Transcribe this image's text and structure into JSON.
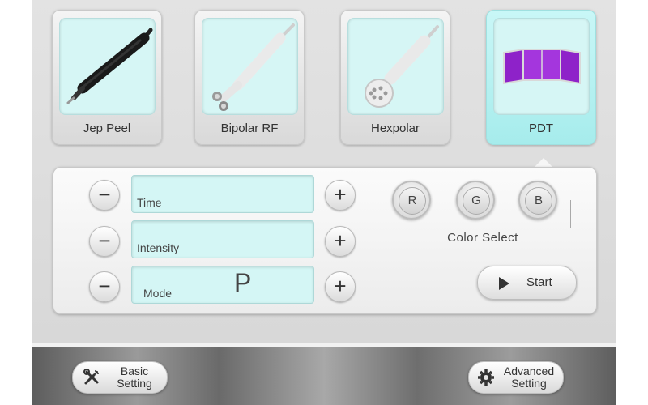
{
  "modes": [
    {
      "label": "Jep Peel",
      "icon": "jep-peel-handpiece-icon",
      "active": false
    },
    {
      "label": "Bipolar RF",
      "icon": "bipolar-rf-handpiece-icon",
      "active": false
    },
    {
      "label": "Hexpolar",
      "icon": "hexpolar-handpiece-icon",
      "active": false
    },
    {
      "label": "PDT",
      "icon": "pdt-light-panel-icon",
      "active": true
    }
  ],
  "controls": {
    "rows": [
      {
        "label": "Time",
        "value": ""
      },
      {
        "label": "Intensity",
        "value": ""
      },
      {
        "label": "Mode",
        "value": "P"
      }
    ],
    "minus_symbol": "−",
    "plus_symbol": "+"
  },
  "color_select": {
    "title": "Color Select",
    "buttons": [
      "R",
      "G",
      "B"
    ]
  },
  "start": {
    "label": "Start",
    "icon": "play-icon"
  },
  "footer": {
    "basic": {
      "line1": "Basic",
      "line2": "Setting",
      "icon": "tools-icon"
    },
    "advanced": {
      "line1": "Advanced",
      "line2": "Setting",
      "icon": "gear-icon"
    }
  },
  "colors": {
    "active_card": "#b5f0f0",
    "field_bg": "#d4f6f5",
    "pdt_panel": "#9b2fd1"
  }
}
